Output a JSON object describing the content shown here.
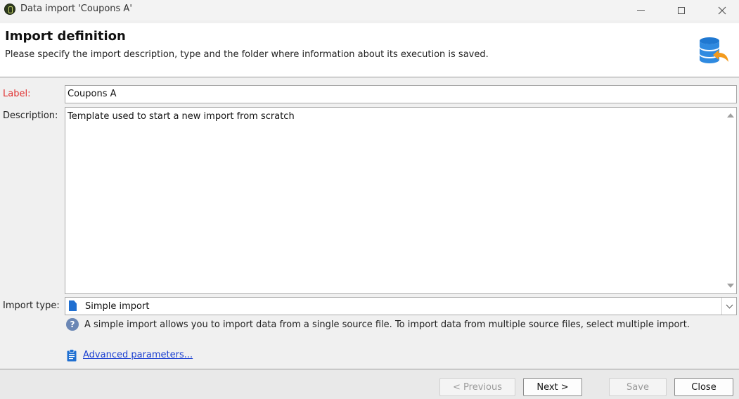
{
  "window": {
    "title": "Data import 'Coupons A'",
    "controls": {
      "minimize_icon": "minimize-icon",
      "maximize_icon": "maximize-icon",
      "close_icon": "close-icon"
    }
  },
  "header": {
    "title": "Import definition",
    "subtitle": "Please specify the import description, type and the folder where information about its execution is saved.",
    "icon": "database-import-icon"
  },
  "form": {
    "label": {
      "label": "Label:",
      "value": "Coupons A"
    },
    "description": {
      "label": "Description:",
      "value": "Template used to start a new import from scratch"
    },
    "import_type": {
      "label": "Import type:",
      "value": "Simple import"
    },
    "help_text": "A simple import allows you to import data from a single source file. To import data from multiple source files, select multiple import.",
    "advanced_link": "Advanced parameters..."
  },
  "footer": {
    "previous": "< Previous",
    "next": "Next >",
    "save": "Save",
    "close": "Close"
  },
  "colors": {
    "required_label": "#e03030",
    "link": "#1a3fd1",
    "doc_icon": "#1f6fd1"
  }
}
